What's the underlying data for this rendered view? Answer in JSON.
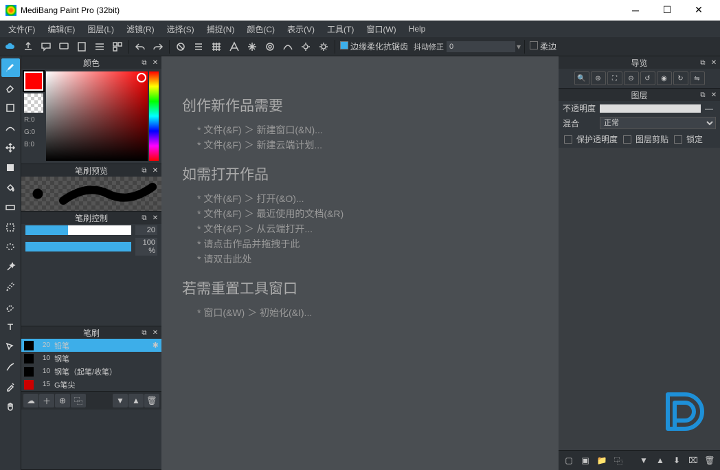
{
  "title": "MediBang Paint Pro (32bit)",
  "menus": [
    "文件(F)",
    "编辑(E)",
    "图层(L)",
    "滤镜(R)",
    "选择(S)",
    "捕捉(N)",
    "颜色(C)",
    "表示(V)",
    "工具(T)",
    "窗口(W)",
    "Help"
  ],
  "toolbar": {
    "antiAlias": "边缘柔化抗锯齿",
    "shakeCorrection": "抖动修正",
    "shakeValue": "0",
    "softEdge": "柔边"
  },
  "panels": {
    "color": "颜色",
    "brushPreview": "笔刷预览",
    "brushControl": "笔刷控制",
    "brush": "笔刷",
    "nav": "导览",
    "layer": "图层"
  },
  "rgb": {
    "r": "R:0",
    "g": "G:0",
    "b": "B:0"
  },
  "brushControl": {
    "sizeVal": "20",
    "opacityVal": "100 %",
    "sizePct": 40,
    "opacityPct": 100
  },
  "brushes": [
    {
      "size": "20",
      "name": "铅笔",
      "color": "#000",
      "sel": true
    },
    {
      "size": "10",
      "name": "钢笔",
      "color": "#000"
    },
    {
      "size": "10",
      "name": "钢笔（起笔/收笔）",
      "color": "#000"
    },
    {
      "size": "15",
      "name": "G笔尖",
      "color": "#c00"
    }
  ],
  "canvas": {
    "h1": "创作新作品需要",
    "l1": "文件(&F) ＞ 新建窗口(&N)...",
    "l2": "文件(&F) ＞ 新建云端计划...",
    "h2": "如需打开作品",
    "l3": "文件(&F) ＞ 打开(&O)...",
    "l4": "文件(&F) ＞ 最近使用的文档(&R)",
    "l5": "文件(&F) ＞ 从云端打开...",
    "l6": "请点击作品并拖拽于此",
    "l7": "请双击此处",
    "h3": "若需重置工具窗口",
    "l8": "窗口(&W) ＞ 初始化(&I)..."
  },
  "layer": {
    "opacity": "不透明度",
    "blend": "混合",
    "blendMode": "正常",
    "protectAlpha": "保护透明度",
    "clipping": "图层剪贴",
    "lock": "锁定"
  }
}
